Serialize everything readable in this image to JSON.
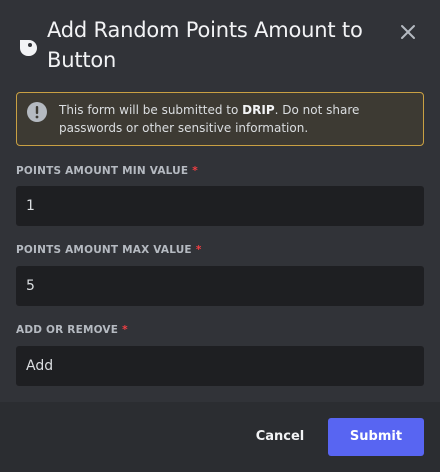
{
  "modal": {
    "title": "Add Random Points Amount to Button",
    "app_icon": "drip-logo-icon",
    "close_icon": "close-icon"
  },
  "warning": {
    "icon": "exclamation-circle-icon",
    "text_before": "This form will be submitted to ",
    "app_name": "DRIP",
    "text_after": ". Do not share passwords or other sensitive information."
  },
  "fields": [
    {
      "label": "POINTS AMOUNT MIN VALUE",
      "required_mark": "*",
      "value": "1"
    },
    {
      "label": "POINTS AMOUNT MAX VALUE",
      "required_mark": "*",
      "value": "5"
    },
    {
      "label": "ADD OR REMOVE",
      "required_mark": "*",
      "value": "Add"
    }
  ],
  "footer": {
    "cancel_label": "Cancel",
    "submit_label": "Submit"
  },
  "colors": {
    "background": "#313338",
    "footer_background": "#2b2d31",
    "input_background": "#1e1f22",
    "warning_border": "#c9a043",
    "required": "#f23f43",
    "accent": "#5865f2"
  }
}
